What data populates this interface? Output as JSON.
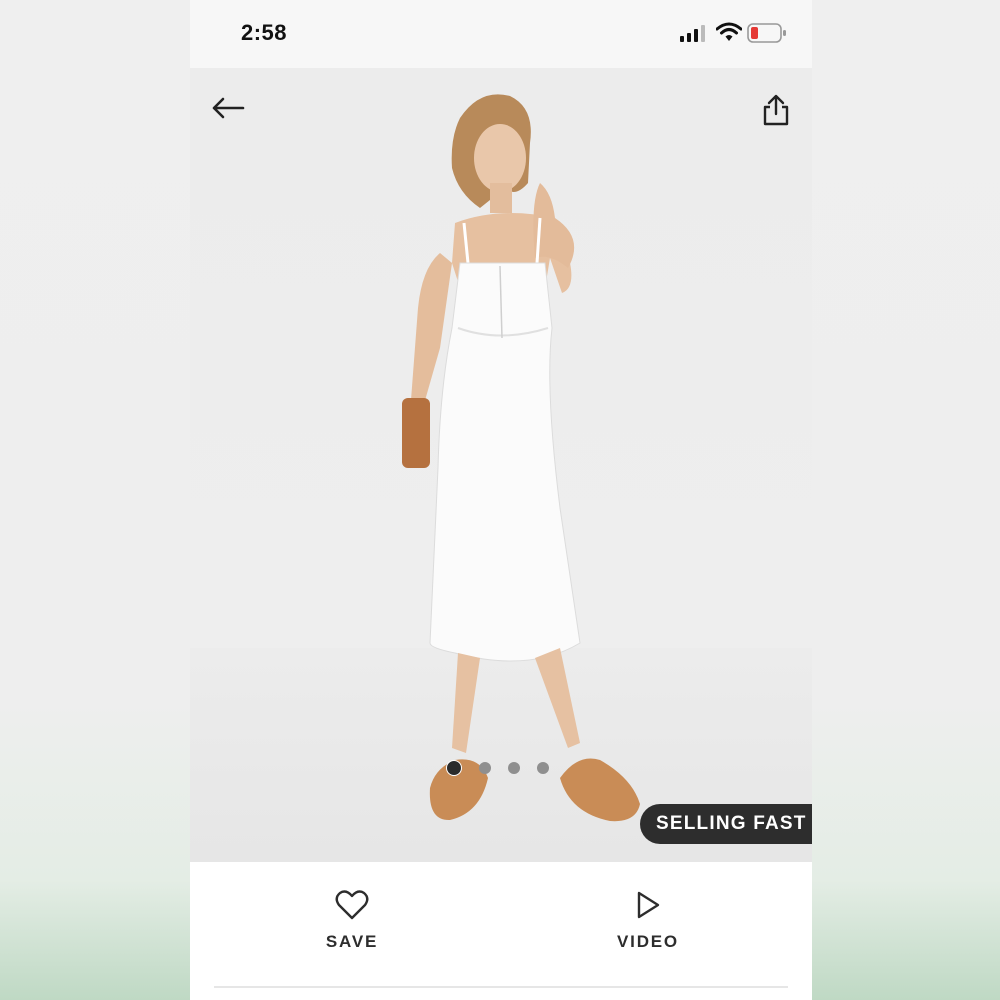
{
  "status_bar": {
    "time": "2:58",
    "battery_color": "#e53935"
  },
  "header": {
    "back_icon": "arrow-left-icon",
    "share_icon": "share-icon"
  },
  "gallery": {
    "image_count": 4,
    "active_index": 0,
    "badge": "SELLING FAST"
  },
  "actions": {
    "save_label": "SAVE",
    "video_label": "VIDEO"
  }
}
